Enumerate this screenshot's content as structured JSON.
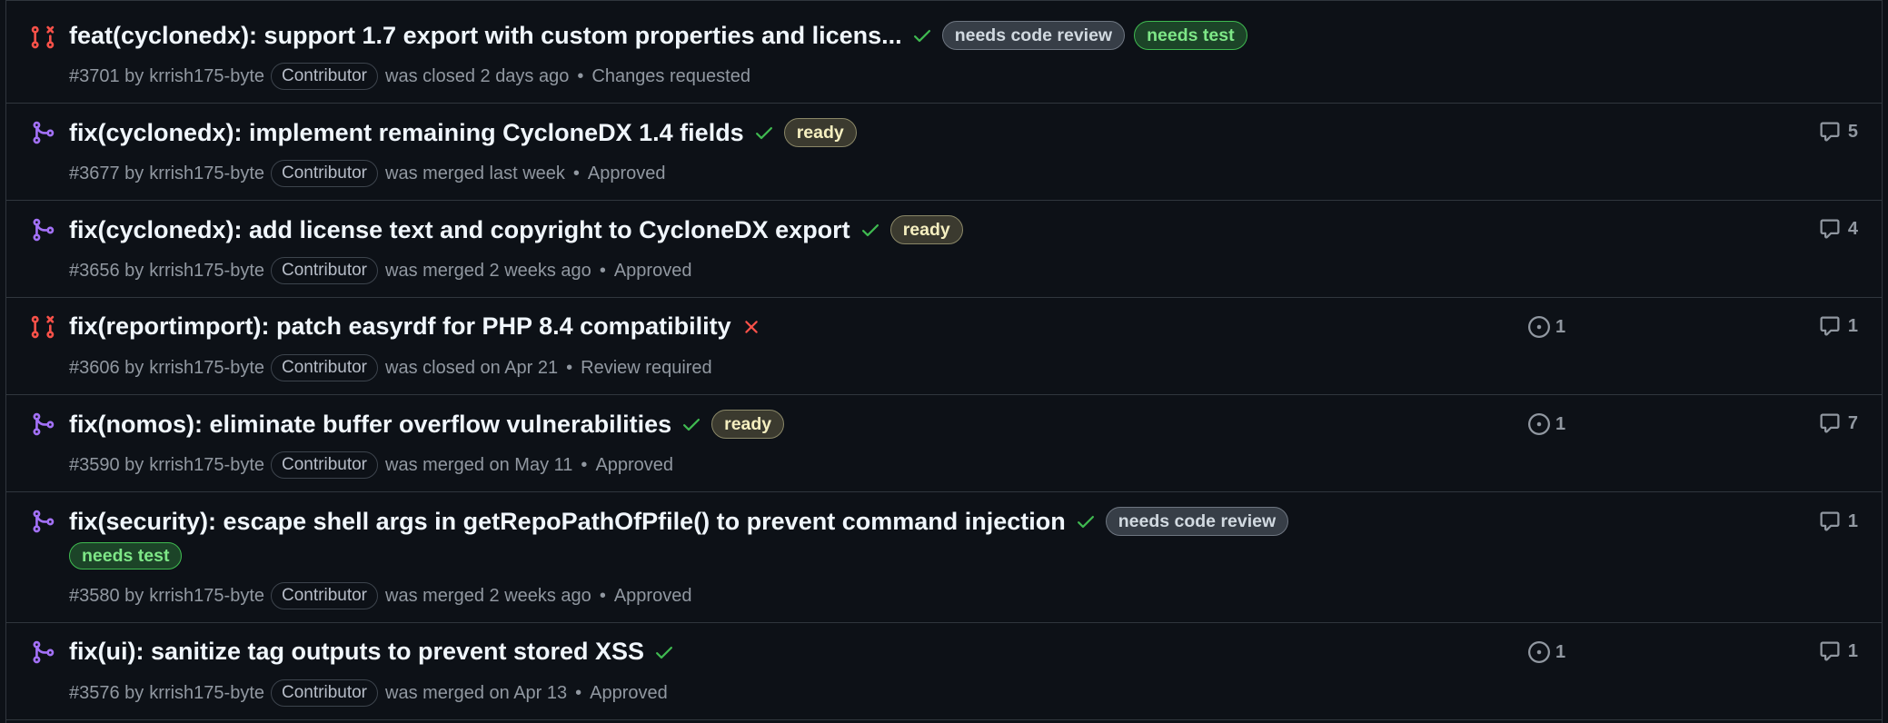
{
  "colors": {
    "background": "#0d1117",
    "border": "#30363d",
    "merged_purple": "#a371f7",
    "closed_red": "#f85149",
    "check_green": "#3fb950",
    "x_red": "#f85149"
  },
  "pull_requests": [
    {
      "state_icon": "git-pull-request-closed-icon",
      "title": "feat(cyclonedx): support 1.7 export with custom properties and licens...",
      "status_icon": "check-icon",
      "labels": [
        "needs code review",
        "needs test"
      ],
      "number_by": "#3701 by",
      "author": "krrish175-byte",
      "role": "Contributor",
      "event": "was closed 2 days ago",
      "review": "Changes requested"
    },
    {
      "state_icon": "git-merge-icon",
      "title": "fix(cyclonedx): implement remaining CycloneDX 1.4 fields",
      "status_icon": "check-icon",
      "labels": [
        "ready"
      ],
      "number_by": "#3677 by",
      "author": "krrish175-byte",
      "role": "Contributor",
      "event": "was merged last week",
      "review": "Approved",
      "comments": "5"
    },
    {
      "state_icon": "git-merge-icon",
      "title": "fix(cyclonedx): add license text and copyright to CycloneDX export",
      "status_icon": "check-icon",
      "labels": [
        "ready"
      ],
      "number_by": "#3656 by",
      "author": "krrish175-byte",
      "role": "Contributor",
      "event": "was merged 2 weeks ago",
      "review": "Approved",
      "comments": "4"
    },
    {
      "state_icon": "git-pull-request-closed-icon",
      "title": "fix(reportimport): patch easyrdf for PHP 8.4 compatibility",
      "status_icon": "x-icon",
      "labels": [],
      "number_by": "#3606 by",
      "author": "krrish175-byte",
      "role": "Contributor",
      "event": "was closed on Apr 21",
      "review": "Review required",
      "linked_issues": "1",
      "comments": "1"
    },
    {
      "state_icon": "git-merge-icon",
      "title": "fix(nomos): eliminate buffer overflow vulnerabilities",
      "status_icon": "check-icon",
      "labels": [
        "ready"
      ],
      "number_by": "#3590 by",
      "author": "krrish175-byte",
      "role": "Contributor",
      "event": "was merged on May 11",
      "review": "Approved",
      "linked_issues": "1",
      "comments": "7"
    },
    {
      "state_icon": "git-merge-icon",
      "title": "fix(security): escape shell args in getRepoPathOfPfile() to prevent command injection",
      "status_icon": "check-icon",
      "labels": [
        "needs code review",
        "needs test"
      ],
      "number_by": "#3580 by",
      "author": "krrish175-byte",
      "role": "Contributor",
      "event": "was merged 2 weeks ago",
      "review": "Approved",
      "comments": "1"
    },
    {
      "state_icon": "git-merge-icon",
      "title": "fix(ui): sanitize tag outputs to prevent stored XSS",
      "status_icon": "check-icon",
      "labels": [],
      "number_by": "#3576 by",
      "author": "krrish175-byte",
      "role": "Contributor",
      "event": "was merged on Apr 13",
      "review": "Approved",
      "linked_issues": "1",
      "comments": "1"
    }
  ]
}
